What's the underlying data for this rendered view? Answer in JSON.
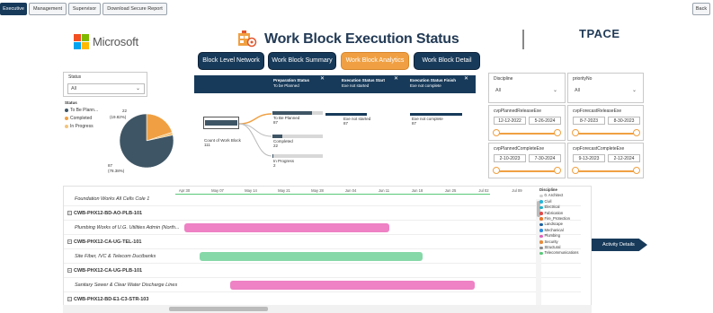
{
  "topbar": {
    "tabs": [
      "Executive",
      "Management",
      "Supervisor",
      "Download Secure Report"
    ],
    "active_tab": "Executive",
    "back_label": "Back"
  },
  "header": {
    "ms_logo_text": "Microsoft",
    "title": "Work Block Execution Status",
    "brand": "TPACE",
    "ms_colors": [
      "#f25022",
      "#7fba00",
      "#00a4ef",
      "#ffb900"
    ]
  },
  "nav": {
    "buttons": [
      "Block Level Network",
      "Work Block Summary",
      "Work Block Analytics",
      "Work Block Detail"
    ],
    "active": "Work Block Analytics"
  },
  "filter_bar": {
    "cols": [
      {
        "label": "Preparation Status",
        "value": "To be Planned"
      },
      {
        "label": "Execution Status Start",
        "value": "Exe not started"
      },
      {
        "label": "Execution Status Finish",
        "value": "Exe not complete"
      }
    ],
    "close_glyph": "✕"
  },
  "status_filter": {
    "label": "Status",
    "value": "All",
    "chevron": "⌄"
  },
  "status_legend": {
    "title": "Status",
    "items": [
      {
        "label": "To Be Plann...",
        "color": "#3e5565"
      },
      {
        "label": "Completed",
        "color": "#f0a042"
      },
      {
        "label": "In Progress",
        "color": "#f4c47a"
      }
    ]
  },
  "pie": {
    "labels": [
      "22\n(19.82%)",
      "87\n(78.38%)"
    ],
    "label_top": "22",
    "label_top_pct": "(19.82%)",
    "label_bottom": "87",
    "label_bottom_pct": "(78.38%)",
    "colors": {
      "to_be_planned": "#3e5565",
      "completed": "#f0a042",
      "in_progress": "#f4c47a"
    },
    "values": {
      "to_be_planned": 87,
      "completed": 22,
      "in_progress": 2
    }
  },
  "decomp": {
    "root_label": "Count of Work Block",
    "root_value": "111",
    "branches": [
      {
        "label": "To Be Planned",
        "value": "87",
        "fill": 0.78
      },
      {
        "label": "Completed",
        "value": "22",
        "fill": 0.2
      },
      {
        "label": "In Progress",
        "value": "2",
        "fill": 0.02
      }
    ],
    "level2": {
      "label": "Exe not started",
      "value": "87"
    },
    "level3": {
      "label": "Exe not complete",
      "value": "87"
    }
  },
  "right_filters": {
    "discipline": {
      "label": "Discipline",
      "value": "All"
    },
    "priority": {
      "label": "priorityNo",
      "value": "All"
    },
    "planned_release": {
      "label": "cvpPlannedReleaseExe",
      "start": "12-12-2022",
      "end": "5-26-2024"
    },
    "forecast_release": {
      "label": "cvpForecastReleaseExe",
      "start": "8-7-2023",
      "end": "8-30-2023"
    },
    "planned_complete": {
      "label": "cvpPlannedCompleteExe",
      "start": "2-10-2023",
      "end": "7-30-2024"
    },
    "forecast_complete": {
      "label": "cvpForecastCompleteExe",
      "start": "9-13-2023",
      "end": "2-12-2024"
    }
  },
  "gantt": {
    "ticks": [
      "Apr 30",
      "May 07",
      "May 14",
      "May 21",
      "May 28",
      "Jun 04",
      "Jun 11",
      "Jun 18",
      "Jun 25",
      "Jul 02",
      "Jul 09"
    ],
    "rows": [
      {
        "label": "Foundation Works All Cells Cole 1",
        "type": "item"
      },
      {
        "label": "CWB-PHX12-BD-AO-PLB-101",
        "type": "group"
      },
      {
        "label": "Plumbing Works of U.G. Utilities Admin (North...",
        "type": "item",
        "bar": {
          "start": 0.03,
          "end": 0.7,
          "color": "#ee82c4"
        }
      },
      {
        "label": "CWB-PHX12-CA-UG-TEL-101",
        "type": "group"
      },
      {
        "label": "Site Fiber, IVC & Telecom Ductbanks",
        "type": "item",
        "bar": {
          "start": 0.08,
          "end": 0.81,
          "color": "#86d8a8"
        }
      },
      {
        "label": "CWB-PHX12-CA-UG-PLB-101",
        "type": "group"
      },
      {
        "label": "Sanitary Sewer & Clear Water Discharge Lines",
        "type": "item",
        "bar": {
          "start": 0.18,
          "end": 0.98,
          "color": "#ee82c4"
        }
      },
      {
        "label": "CWB-PHX12-BD-E1-C3-STR-103",
        "type": "group"
      }
    ],
    "expand_glyph": "−"
  },
  "gantt_legend": {
    "title": "Discipline",
    "items": [
      {
        "label": "0. Architect",
        "color": "#cfcfcf"
      },
      {
        "label": "Civil",
        "color": "#28b4d8"
      },
      {
        "label": "Electrical",
        "color": "#1fb0c8"
      },
      {
        "label": "Fabrication",
        "color": "#e04848"
      },
      {
        "label": "Fire_Protection",
        "color": "#e8742a"
      },
      {
        "label": "Landscape",
        "color": "#1a5fa0"
      },
      {
        "label": "Mechanical",
        "color": "#2c8ee0"
      },
      {
        "label": "Plumbing",
        "color": "#e060b8"
      },
      {
        "label": "Security",
        "color": "#e88a3a"
      },
      {
        "label": "Structural",
        "color": "#8a8a8a"
      },
      {
        "label": "Telecommunications",
        "color": "#5ac878"
      }
    ]
  },
  "activity_details": "Activity Details"
}
